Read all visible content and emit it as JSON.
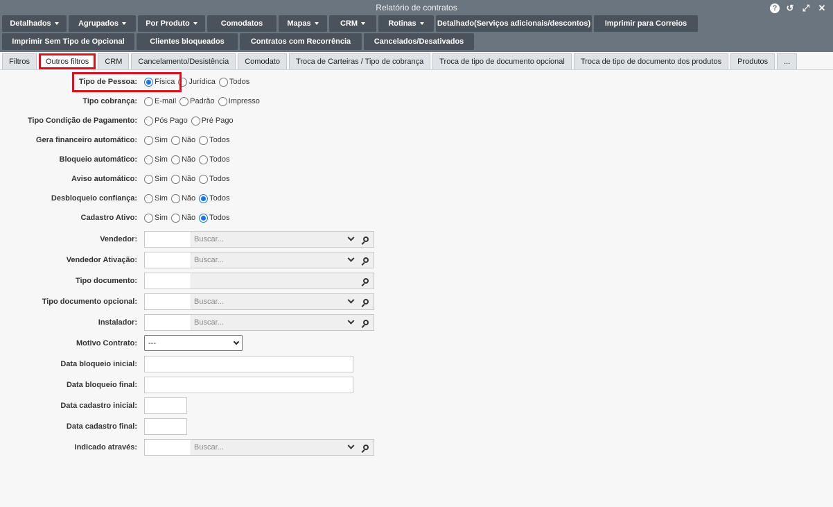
{
  "window": {
    "title": "Relatório de contratos",
    "icons": [
      "help-icon",
      "history-icon",
      "expand-icon",
      "close-icon"
    ]
  },
  "toolbar": {
    "row1": [
      {
        "label": "Detalhados",
        "dropdown": true
      },
      {
        "label": "Agrupados",
        "dropdown": true
      },
      {
        "label": "Por Produto",
        "dropdown": true
      },
      {
        "label": "Comodatos",
        "dropdown": false
      },
      {
        "label": "Mapas",
        "dropdown": true
      },
      {
        "label": "CRM",
        "dropdown": true
      },
      {
        "label": "Rotinas",
        "dropdown": true
      },
      {
        "label": "Detalhado(Serviços adicionais/descontos)",
        "dropdown": false
      },
      {
        "label": "Imprimir para Correios",
        "dropdown": false
      }
    ],
    "row2": [
      {
        "label": "Imprimir Sem Tipo de Opcional"
      },
      {
        "label": "Clientes bloqueados"
      },
      {
        "label": "Contratos com Recorrência"
      },
      {
        "label": "Cancelados/Desativados"
      }
    ]
  },
  "tabs": [
    {
      "label": "Filtros",
      "active": false
    },
    {
      "label": "Outros filtros",
      "active": true
    },
    {
      "label": "CRM",
      "active": false
    },
    {
      "label": "Cancelamento/Desistência",
      "active": false
    },
    {
      "label": "Comodato",
      "active": false
    },
    {
      "label": "Troca de Carteiras / Tipo de cobrança",
      "active": false
    },
    {
      "label": "Troca de tipo de documento opcional",
      "active": false
    },
    {
      "label": "Troca de tipo de documento dos produtos",
      "active": false
    },
    {
      "label": "Produtos",
      "active": false
    },
    {
      "label": "...",
      "active": false
    }
  ],
  "radio_groups": [
    {
      "label": "Tipo de Pessoa:",
      "options": [
        "Física",
        "Jurídica",
        "Todos"
      ],
      "selected": 0
    },
    {
      "label": "Tipo cobrança:",
      "options": [
        "E-mail",
        "Padrão",
        "Impresso"
      ],
      "selected": -1
    },
    {
      "label": "Tipo Condição de Pagamento:",
      "options": [
        "Pós Pago",
        "Pré Pago"
      ],
      "selected": -1
    },
    {
      "label": "Gera financeiro automático:",
      "options": [
        "Sim",
        "Não",
        "Todos"
      ],
      "selected": -1
    },
    {
      "label": "Bloqueio automático:",
      "options": [
        "Sim",
        "Não",
        "Todos"
      ],
      "selected": -1
    },
    {
      "label": "Aviso automático:",
      "options": [
        "Sim",
        "Não",
        "Todos"
      ],
      "selected": -1
    },
    {
      "label": "Desbloqueio confiança:",
      "options": [
        "Sim",
        "Não",
        "Todos"
      ],
      "selected": 2
    },
    {
      "label": "Cadastro Ativo:",
      "options": [
        "Sim",
        "Não",
        "Todos"
      ],
      "selected": 2
    }
  ],
  "lookups": [
    {
      "label": "Vendedor:",
      "placeholder": "Buscar...",
      "has_dropdown": true
    },
    {
      "label": "Vendedor Ativação:",
      "placeholder": "Buscar...",
      "has_dropdown": true
    },
    {
      "label": "Tipo documento:",
      "placeholder": "",
      "has_dropdown": false
    },
    {
      "label": "Tipo documento opcional:",
      "placeholder": "Buscar...",
      "has_dropdown": true
    },
    {
      "label": "Instalador:",
      "placeholder": "Buscar...",
      "has_dropdown": true
    }
  ],
  "motivo": {
    "label": "Motivo Contrato:",
    "value": "---"
  },
  "date_fields": [
    {
      "label": "Data bloqueio inicial:",
      "size": "wide"
    },
    {
      "label": "Data bloqueio final:",
      "size": "wide"
    },
    {
      "label": "Data cadastro inicial:",
      "size": "small"
    },
    {
      "label": "Data cadastro final:",
      "size": "small"
    }
  ],
  "indicado": {
    "label": "Indicado através:",
    "placeholder": "Buscar..."
  },
  "colors": {
    "highlight": "#e0101b",
    "toolbar": "#4a525b",
    "titlebar": "#6b7580",
    "radio_on": "#1a73e8"
  }
}
